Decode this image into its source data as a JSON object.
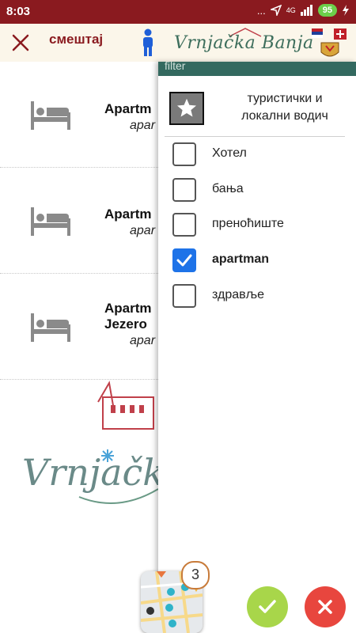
{
  "status_bar": {
    "time": "8:03",
    "dots": "...",
    "network": "4G",
    "battery": "95"
  },
  "header": {
    "title": "смештај",
    "brand": "Vrnjačka Banja"
  },
  "list": {
    "items": [
      {
        "name": "Apartm",
        "subtitle": "apar"
      },
      {
        "name": "Apartm",
        "subtitle": "apar"
      },
      {
        "name": "Apartm",
        "name2": "Jezero",
        "subtitle": "apar"
      }
    ],
    "logo_text": "Vrnjačk"
  },
  "filter": {
    "heading": "filter",
    "guide_label": "туристички и локални водич",
    "options": [
      {
        "label": "Хотел",
        "checked": false
      },
      {
        "label": "бања",
        "checked": false
      },
      {
        "label": "преноћиште",
        "checked": false
      },
      {
        "label": "apartman",
        "checked": true
      },
      {
        "label": "здравље",
        "checked": false
      }
    ]
  },
  "map": {
    "count": "3"
  },
  "colors": {
    "brand_red": "#8a1a1f",
    "drawer_green": "#33695f",
    "check_blue": "#1e73e8",
    "ok_green": "#a8d64a",
    "cancel_red": "#e8463e"
  }
}
